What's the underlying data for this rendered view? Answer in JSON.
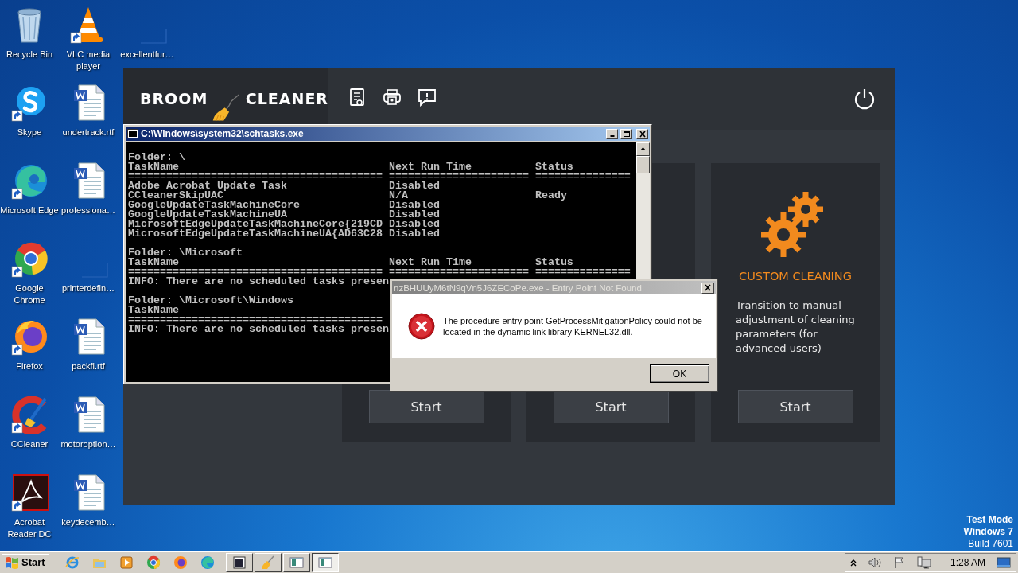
{
  "desktop": {
    "icons": [
      {
        "label": "Recycle Bin",
        "kind": "recycle",
        "shortcut": false
      },
      {
        "label": "Skype",
        "kind": "skype",
        "shortcut": true
      },
      {
        "label": "Microsoft Edge",
        "kind": "edge",
        "shortcut": true
      },
      {
        "label": "Google Chrome",
        "kind": "chrome",
        "shortcut": true
      },
      {
        "label": "Firefox",
        "kind": "firefox",
        "shortcut": true
      },
      {
        "label": "CCleaner",
        "kind": "ccleaner",
        "shortcut": true
      },
      {
        "label": "Acrobat Reader DC",
        "kind": "acrobat",
        "shortcut": true
      },
      {
        "label": "VLC media player",
        "kind": "vlc",
        "shortcut": true
      },
      {
        "label": "undertrack.rtf",
        "kind": "word",
        "shortcut": false
      },
      {
        "label": "professiona…",
        "kind": "word",
        "shortcut": false
      },
      {
        "label": "printerdefin…",
        "kind": "blank",
        "shortcut": false
      },
      {
        "label": "packfl.rtf",
        "kind": "word",
        "shortcut": false
      },
      {
        "label": "motoroption…",
        "kind": "word",
        "shortcut": false
      },
      {
        "label": "keydecemb…",
        "kind": "word",
        "shortcut": false
      },
      {
        "label": "excellentfur…",
        "kind": "blank",
        "shortcut": false
      }
    ]
  },
  "broom_cleaner": {
    "logo_left": "BROOM",
    "logo_right": "CLEANER",
    "toolbar": [
      {
        "kind": "certificate"
      },
      {
        "kind": "printer"
      },
      {
        "kind": "feedback"
      }
    ],
    "cards": [
      {
        "start": "Start"
      },
      {
        "start": "Start"
      },
      {
        "title": "CUSTOM CLEANING",
        "description": "Transition to manual adjustment of cleaning parameters (for advanced users)",
        "start": "Start"
      }
    ]
  },
  "console": {
    "title": "C:\\Windows\\system32\\schtasks.exe",
    "blocks": [
      [
        "Folder: \\",
        "TaskName                                 Next Run Time          Status",
        "======================================== ====================== ===============",
        "Adobe Acrobat Update Task                Disabled",
        "CCleanerSkipUAC                          N/A                    Ready",
        "GoogleUpdateTaskMachineCore              Disabled",
        "GoogleUpdateTaskMachineUA                Disabled",
        "MicrosoftEdgeUpdateTaskMachineCore{219CD Disabled",
        "MicrosoftEdgeUpdateTaskMachineUA{AD63C28 Disabled"
      ],
      [
        "Folder: \\Microsoft",
        "TaskName                                 Next Run Time          Status",
        "======================================== ====================== ===============",
        "INFO: There are no scheduled tasks presen"
      ],
      [
        "Folder: \\Microsoft\\Windows",
        "TaskName",
        "========================================",
        "INFO: There are no scheduled tasks presen"
      ]
    ]
  },
  "error_dialog": {
    "title": "nzBHUUyM6tN9qVn5J6ZECoPe.exe - Entry Point Not Found",
    "message": "The procedure entry point GetProcessMitigationPolicy could not be located in the dynamic link library KERNEL32.dll.",
    "ok": "OK"
  },
  "system_notice": [
    {
      "text": "Test Mode",
      "bold": true
    },
    {
      "text": "Windows 7",
      "bold": true
    },
    {
      "text": "Build 7601",
      "bold": false
    }
  ],
  "taskbar": {
    "start": "Start",
    "quick_launch": [
      {
        "kind": "ie"
      },
      {
        "kind": "folder"
      },
      {
        "kind": "media"
      },
      {
        "kind": "chrome"
      },
      {
        "kind": "firefox"
      },
      {
        "kind": "edge"
      }
    ],
    "tasks": [
      {
        "kind": "console",
        "selected": false
      },
      {
        "kind": "broom",
        "selected": false
      },
      {
        "kind": "window",
        "selected": false
      },
      {
        "kind": "window",
        "selected": true
      }
    ],
    "clock": "1:28 AM"
  }
}
